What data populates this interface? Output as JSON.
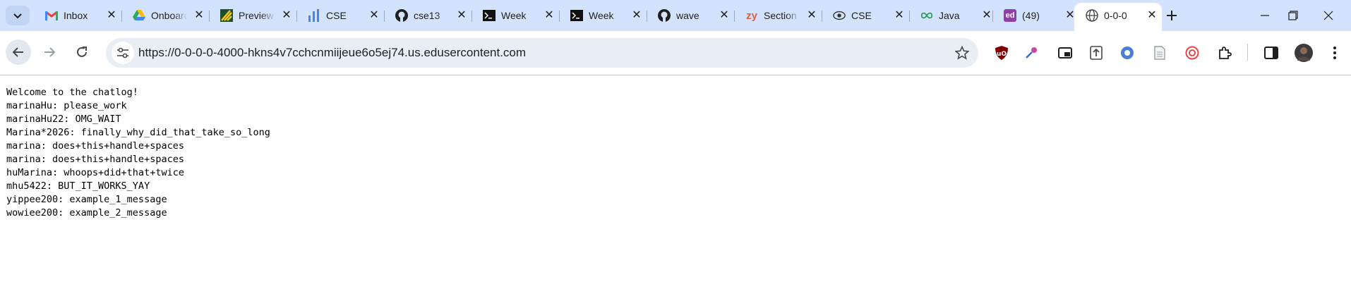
{
  "tabs": [
    {
      "title": "Inbox",
      "icon": "gmail-icon",
      "active": false
    },
    {
      "title": "Onboarding",
      "icon": "google-drive-icon",
      "active": false
    },
    {
      "title": "Preview",
      "icon": "preview-icon",
      "active": false
    },
    {
      "title": "CSE",
      "icon": "bar-chart-icon",
      "active": false
    },
    {
      "title": "cse13",
      "icon": "github-icon",
      "active": false
    },
    {
      "title": "Week",
      "icon": "terminal-icon",
      "active": false
    },
    {
      "title": "Week",
      "icon": "terminal-icon",
      "active": false
    },
    {
      "title": "wave",
      "icon": "github-icon",
      "active": false
    },
    {
      "title": "Section",
      "icon": "zybooks-icon",
      "active": false
    },
    {
      "title": "CSE",
      "icon": "eye-icon",
      "active": false
    },
    {
      "title": "Java",
      "icon": "infinity-icon",
      "active": false
    },
    {
      "title": "(49)",
      "icon": "ed-icon",
      "active": false
    },
    {
      "title": "0-0-0",
      "icon": "globe-icon",
      "active": true
    }
  ],
  "address_bar": {
    "url": "https://0-0-0-0-4000-hkns4v7cchcnmiijeue6o5ej74.us.edusercontent.com"
  },
  "extensions": [
    "ublock-icon",
    "eyedropper-icon",
    "picture-in-picture-icon",
    "upload-icon",
    "circle-badge-icon",
    "document-icon",
    "settings-badge-icon",
    "puzzle-icon"
  ],
  "chatlog": [
    "Welcome to the chatlog!",
    "marinaHu: please_work",
    "marinaHu22: OMG_WAIT",
    "Marina*2026: finally_why_did_that_take_so_long",
    "marina: does+this+handle+spaces",
    "marina: does+this+handle+spaces",
    "huMarina: whoops+did+that+twice",
    "mhu5422: BUT_IT_WORKS_YAY",
    "yippee200: example_1_message",
    "wowiee200: example_2_message"
  ],
  "colors": {
    "tabstrip_bg": "#d3e3fd",
    "omnibox_bg": "#e9eef6"
  }
}
